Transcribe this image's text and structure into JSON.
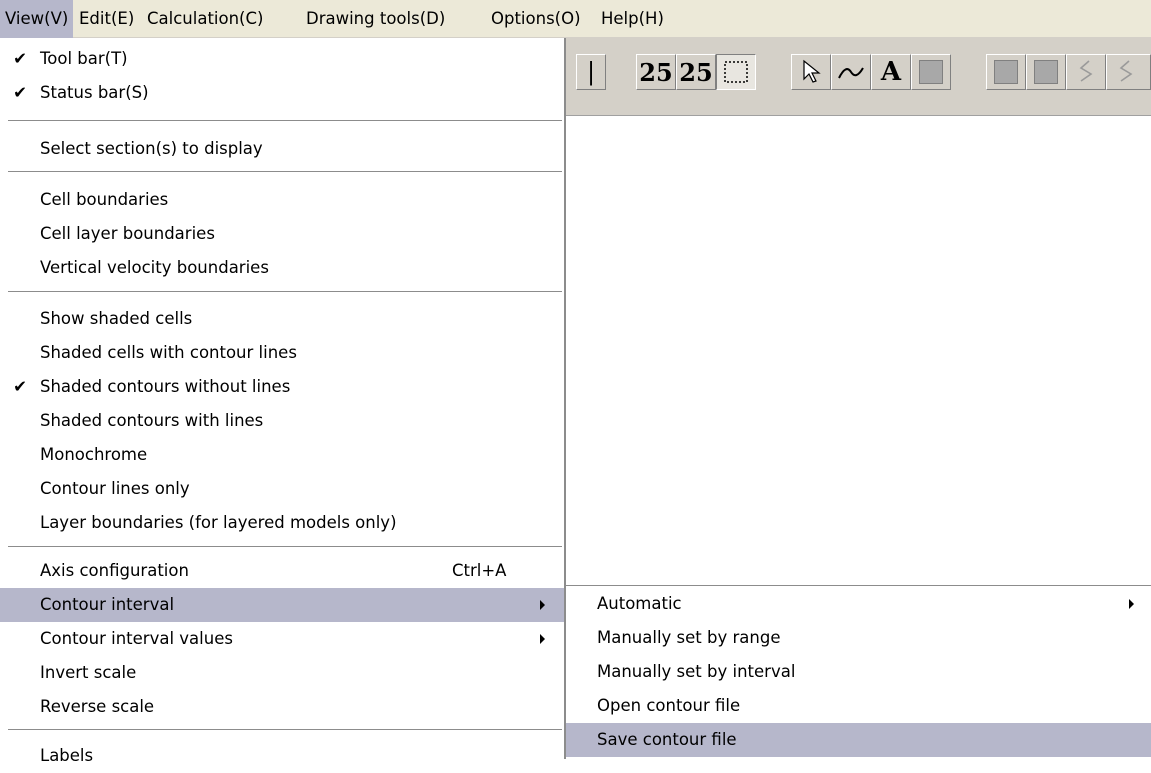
{
  "menubar": {
    "items": [
      {
        "label": "View(V)"
      },
      {
        "label": "Edit(E)"
      },
      {
        "label": "Calculation(C)"
      },
      {
        "label": "Drawing tools(D)"
      },
      {
        "label": "Options(O)"
      },
      {
        "label": "Help(H)"
      }
    ],
    "active_item": "View(V)"
  },
  "toolbar": {
    "buttons": [
      {
        "label": "|"
      },
      {
        "label": "25"
      },
      {
        "label": "25"
      }
    ],
    "icons": [
      "line-icon",
      "font-size-a-icon",
      "font-size-b-icon",
      "select-rectangle-icon",
      "pointer-icon",
      "curve-icon",
      "text-tool-icon",
      "fill-icon",
      "gray-square-icon",
      "gray-square-icon",
      "zigzag-icon",
      "zigzag-icon"
    ]
  },
  "view_menu": {
    "items": [
      {
        "label": "Tool bar(T)",
        "checked": true
      },
      {
        "label": "Status bar(S)",
        "checked": true
      },
      {
        "label": "Select section(s) to display"
      },
      {
        "label": "Cell boundaries"
      },
      {
        "label": "Cell layer boundaries"
      },
      {
        "label": "Vertical velocity boundaries"
      },
      {
        "label": "Show shaded cells"
      },
      {
        "label": "Shaded cells with contour lines"
      },
      {
        "label": "Shaded contours without lines",
        "checked": true
      },
      {
        "label": "Shaded contours with lines"
      },
      {
        "label": "Monochrome"
      },
      {
        "label": "Contour lines only"
      },
      {
        "label": "Layer boundaries (for layered models only)"
      },
      {
        "label": "Axis configuration",
        "shortcut": "Ctrl+A"
      },
      {
        "label": "Contour interval",
        "submenu": true,
        "highlighted": true
      },
      {
        "label": "Contour interval values",
        "submenu": true
      },
      {
        "label": "Invert scale"
      },
      {
        "label": "Reverse scale"
      },
      {
        "label": "Labels"
      }
    ],
    "check_glyph": "✔"
  },
  "contour_interval_submenu": {
    "items": [
      {
        "label": "Automatic",
        "submenu": true
      },
      {
        "label": "Manually set by range"
      },
      {
        "label": "Manually set by interval"
      },
      {
        "label": "Open contour file"
      },
      {
        "label": "Save contour file",
        "highlighted": true
      }
    ]
  },
  "colors": {
    "menubar_bg": "#ece9d8",
    "highlight": "#b6b7cb",
    "toolbar_bg": "#d4d0c8"
  }
}
